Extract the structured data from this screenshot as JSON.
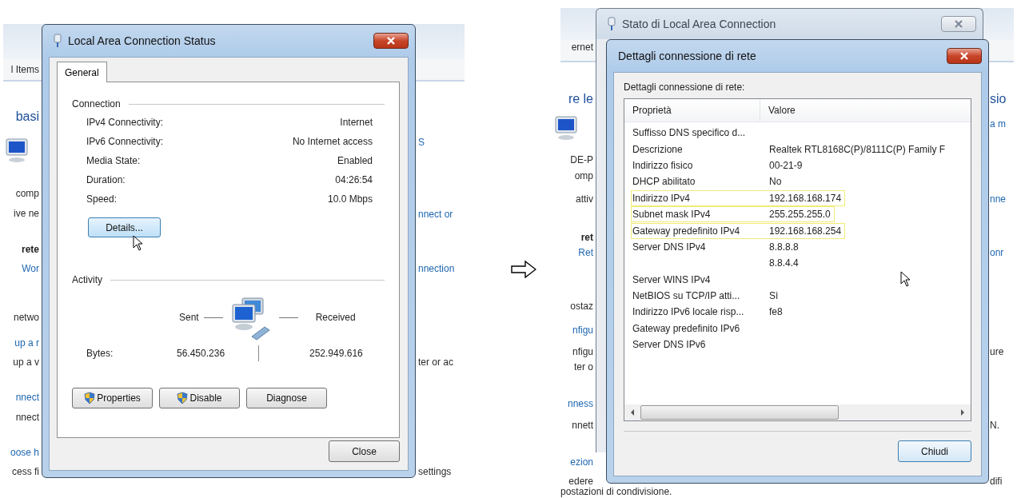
{
  "left_screenshot": {
    "background_left": [
      {
        "text": "l Items",
        "kind": "plain"
      },
      {
        "text": "basi",
        "kind": "heading"
      },
      {
        "text": "comp",
        "kind": "plain"
      },
      {
        "text": "ive ne",
        "kind": "plain"
      },
      {
        "text": "rete",
        "kind": "bold"
      },
      {
        "text": "Wor",
        "kind": "link"
      },
      {
        "text": "netwo",
        "kind": "plain"
      },
      {
        "text": "up a r",
        "kind": "link"
      },
      {
        "text": "up a v",
        "kind": "plain"
      },
      {
        "text": "nnect",
        "kind": "link"
      },
      {
        "text": "nnect",
        "kind": "plain"
      },
      {
        "text": "oose h",
        "kind": "link"
      },
      {
        "text": "cess fi",
        "kind": "plain"
      }
    ],
    "background_right": [
      {
        "text": "S",
        "kind": "link"
      },
      {
        "text": "nnect or",
        "kind": "link"
      },
      {
        "text": "nnection",
        "kind": "link"
      },
      {
        "text": "ter or ac",
        "kind": "plain"
      },
      {
        "text": "settings",
        "kind": "plain"
      }
    ],
    "dialog": {
      "title": "Local Area Connection Status",
      "tabs": [
        {
          "label": "General",
          "selected": true
        }
      ],
      "connection": {
        "heading": "Connection",
        "rows": [
          {
            "label": "IPv4 Connectivity:",
            "value": "Internet"
          },
          {
            "label": "IPv6 Connectivity:",
            "value": "No Internet access"
          },
          {
            "label": "Media State:",
            "value": "Enabled"
          },
          {
            "label": "Duration:",
            "value": "04:26:54"
          },
          {
            "label": "Speed:",
            "value": "10.0 Mbps"
          }
        ],
        "details_button": "Details..."
      },
      "activity": {
        "heading": "Activity",
        "sent_label": "Sent",
        "received_label": "Received",
        "bytes_label": "Bytes:",
        "sent": "56.450.236",
        "received": "252.949.616"
      },
      "buttons": [
        {
          "label": "Properties",
          "shield": true
        },
        {
          "label": "Disable",
          "shield": true
        },
        {
          "label": "Diagnose",
          "shield": false
        }
      ],
      "close_button": "Close"
    }
  },
  "right_screenshot": {
    "background_left": [
      {
        "text": "ernet",
        "kind": "plain"
      },
      {
        "text": "re le",
        "kind": "heading"
      },
      {
        "text": "DE-P",
        "kind": "plain"
      },
      {
        "text": "omp",
        "kind": "plain"
      },
      {
        "text": "attiv",
        "kind": "plain"
      },
      {
        "text": "ret",
        "kind": "bold"
      },
      {
        "text": "Ret",
        "kind": "link"
      },
      {
        "text": "ostaz",
        "kind": "plain"
      },
      {
        "text": "nfigu",
        "kind": "link"
      },
      {
        "text": "nfigu",
        "kind": "plain"
      },
      {
        "text": "ter o",
        "kind": "plain"
      },
      {
        "text": "nness",
        "kind": "link"
      },
      {
        "text": "nnett",
        "kind": "plain"
      },
      {
        "text": "ezion",
        "kind": "link"
      },
      {
        "text": "edere",
        "kind": "plain"
      },
      {
        "text": "postazioni di condivisione.",
        "kind": "plain"
      }
    ],
    "background_right": [
      {
        "text": "sio",
        "kind": "heading"
      },
      {
        "text": "a m",
        "kind": "link"
      },
      {
        "text": "nne",
        "kind": "link"
      },
      {
        "text": "onr",
        "kind": "link"
      },
      {
        "text": "ure",
        "kind": "plain"
      },
      {
        "text": "N.",
        "kind": "plain"
      },
      {
        "text": "difi",
        "kind": "plain"
      }
    ],
    "back_window": {
      "title": "Stato di Local Area Connection"
    },
    "dialog": {
      "title": "Dettagli connessione di rete",
      "caption": "Dettagli connessione di rete:",
      "columns": [
        "Proprietà",
        "Valore"
      ],
      "rows": [
        {
          "property": "Suffisso DNS specifico d...",
          "highlighted": false
        },
        {
          "property": "Descrizione",
          "value": "Realtek RTL8168C(P)/8111C(P) Family F",
          "highlighted": false
        },
        {
          "property": "Indirizzo fisico",
          "value": "00-21-9",
          "highlighted": false
        },
        {
          "property": "DHCP abilitato",
          "value": "No",
          "highlighted": false
        },
        {
          "property": "Indirizzo IPv4",
          "value": "192.168.168.174",
          "highlighted": true
        },
        {
          "property": "Subnet mask IPv4",
          "value": "255.255.255.0",
          "highlighted": true
        },
        {
          "property": "Gateway predefinito IPv4",
          "value": "192.168.168.254",
          "highlighted": true
        },
        {
          "property": "Server DNS IPv4",
          "value": "8.8.8.8",
          "highlighted": false
        },
        {
          "value": "8.8.4.4",
          "highlighted": false
        },
        {
          "property": "Server WINS IPv4",
          "highlighted": false
        },
        {
          "property": "NetBIOS su TCP/IP atti...",
          "value": "Sì",
          "highlighted": false
        },
        {
          "property": "Indirizzo IPv6 locale risp...",
          "value": "fe8",
          "highlighted": false
        },
        {
          "property": "Gateway predefinito IPv6",
          "highlighted": false
        },
        {
          "property": "Server DNS IPv6",
          "highlighted": false
        }
      ],
      "close_button": "Chiudi"
    }
  }
}
